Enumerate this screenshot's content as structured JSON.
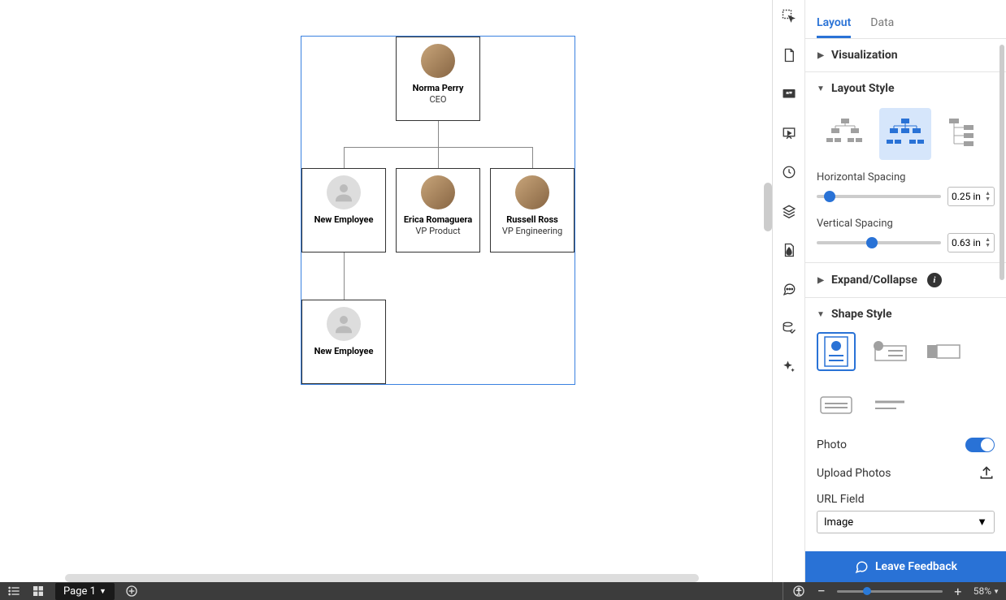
{
  "chart_data": {
    "type": "org-chart",
    "root": {
      "name": "Norma Perry",
      "role": "CEO",
      "children": [
        {
          "name": "New Employee",
          "role": "",
          "children": [
            {
              "name": "New Employee",
              "role": ""
            }
          ]
        },
        {
          "name": "Erica Romaguera",
          "role": "VP Product"
        },
        {
          "name": "Russell Ross",
          "role": "VP Engineering"
        }
      ]
    }
  },
  "org": {
    "n1_name": "Norma Perry",
    "n1_role": "CEO",
    "n2_name": "New Employee",
    "n3_name": "Erica Romaguera",
    "n3_role": "VP Product",
    "n4_name": "Russell Ross",
    "n4_role": "VP Engineering",
    "n5_name": "New Employee"
  },
  "panel": {
    "tabs": {
      "layout": "Layout",
      "data": "Data"
    },
    "visualization": "Visualization",
    "layout_style": "Layout Style",
    "hspacing_label": "Horizontal Spacing",
    "hspacing_val": "0.25 in",
    "vspacing_label": "Vertical Spacing",
    "vspacing_val": "0.63 in",
    "expand_collapse": "Expand/Collapse",
    "shape_style": "Shape Style",
    "photo_label": "Photo",
    "upload_label": "Upload Photos",
    "url_field_label": "URL Field",
    "url_field_value": "Image"
  },
  "feedback_label": "Leave Feedback",
  "bottom": {
    "page_label": "Page 1",
    "zoom_label": "58%"
  }
}
